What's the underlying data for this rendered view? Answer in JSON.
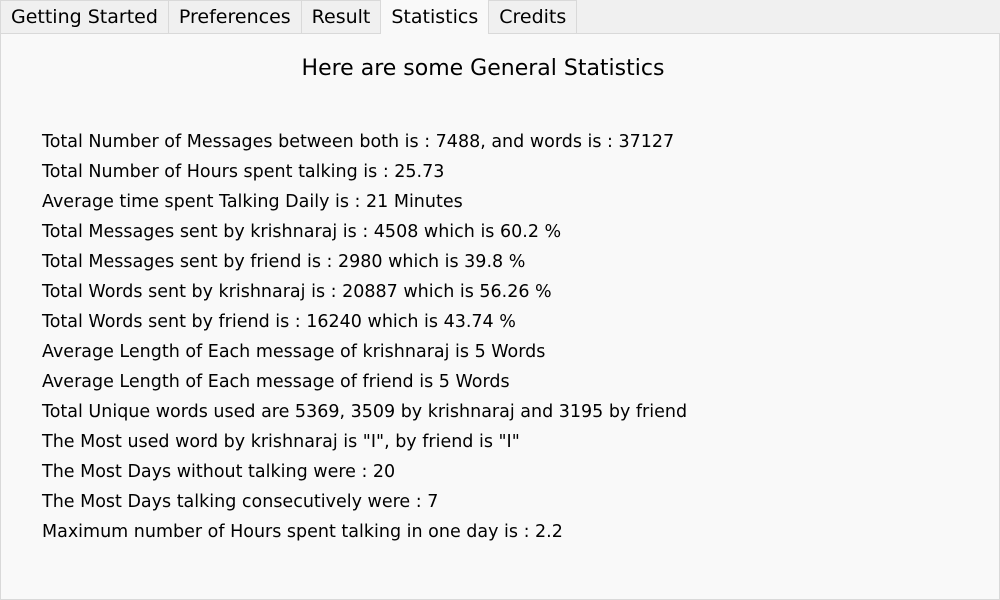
{
  "tabs": [
    {
      "label": "Getting Started"
    },
    {
      "label": "Preferences"
    },
    {
      "label": "Result"
    },
    {
      "label": "Statistics",
      "active": true
    },
    {
      "label": "Credits"
    }
  ],
  "statistics": {
    "heading": "Here are some General Statistics",
    "lines": [
      "Total Number of Messages between both is : 7488, and words is : 37127",
      "Total Number of Hours spent talking is : 25.73",
      "Average time spent Talking Daily is : 21 Minutes",
      "Total Messages sent by krishnaraj is : 4508 which is 60.2 %",
      "Total Messages sent by friend is : 2980 which is 39.8 %",
      "Total Words sent by krishnaraj is : 20887 which is 56.26 %",
      "Total Words sent by friend is : 16240 which is 43.74 %",
      "Average Length of Each message of krishnaraj is 5 Words",
      "Average Length of Each message of friend is 5 Words",
      "Total Unique words used are 5369, 3509 by krishnaraj and 3195 by friend",
      "The Most used word by krishnaraj is \"I\", by friend is \"I\"",
      "The Most Days without talking were : 20",
      "The Most Days talking consecutively were : 7",
      "Maximum number of Hours spent talking in one day is : 2.2"
    ]
  },
  "colors": {
    "window_background": "#f0f0f0",
    "panel_background": "#f9f9f9",
    "border": "#d9d9d9",
    "text": "#000000"
  }
}
